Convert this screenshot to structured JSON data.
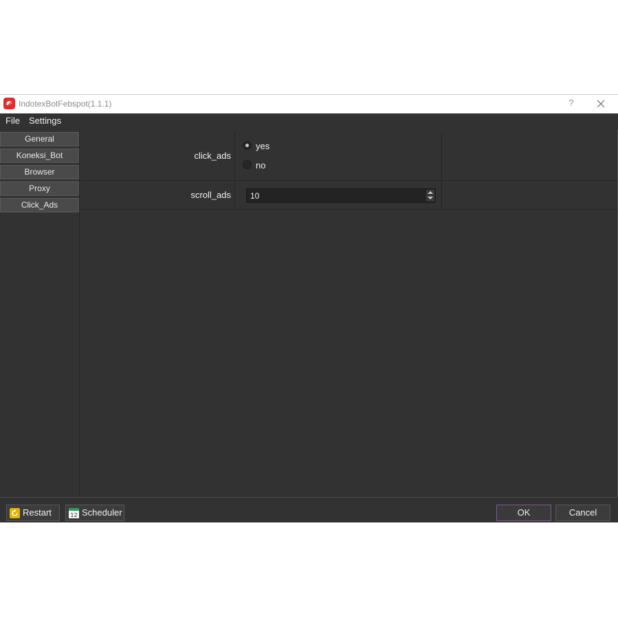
{
  "window": {
    "title": "IndotexBotFebspot(1.1.1)",
    "help_glyph": "?",
    "accent_color": "#e22b2b"
  },
  "menubar": {
    "items": [
      "File",
      "Settings"
    ]
  },
  "sidebar": {
    "items": [
      {
        "label": "General"
      },
      {
        "label": "Koneksi_Bot"
      },
      {
        "label": "Browser"
      },
      {
        "label": "Proxy"
      },
      {
        "label": "Click_Ads"
      }
    ]
  },
  "settings": {
    "click_ads": {
      "label": "click_ads",
      "options": [
        "yes",
        "no"
      ],
      "selected": "yes"
    },
    "scroll_ads": {
      "label": "scroll_ads",
      "value": "10"
    }
  },
  "footer": {
    "restart_label": "Restart",
    "scheduler_label": "Scheduler",
    "scheduler_icon_text": "12",
    "ok_label": "OK",
    "cancel_label": "Cancel"
  }
}
